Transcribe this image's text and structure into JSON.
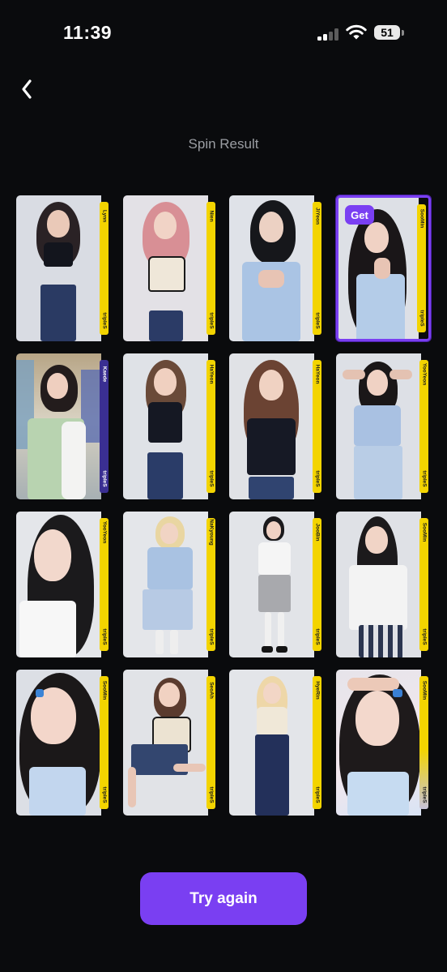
{
  "status_bar": {
    "time": "11:39",
    "battery": "51"
  },
  "page": {
    "title": "Spin Result"
  },
  "cards": [
    {
      "member": "Lynn",
      "brand": "tripleS",
      "strip_color": "yellow"
    },
    {
      "member": "Nien",
      "brand": "tripleS",
      "strip_color": "yellow"
    },
    {
      "member": "JiYeon",
      "brand": "tripleS",
      "strip_color": "yellow"
    },
    {
      "member": "SooMin",
      "brand": "tripleS",
      "strip_color": "yellow",
      "badge": "Get"
    },
    {
      "member": "Kaede",
      "brand": "tripleS",
      "strip_color": "purple"
    },
    {
      "member": "HaYeon",
      "brand": "tripleS",
      "strip_color": "yellow"
    },
    {
      "member": "HaYeon",
      "brand": "tripleS",
      "strip_color": "yellow"
    },
    {
      "member": "YooYeon",
      "brand": "tripleS",
      "strip_color": "yellow"
    },
    {
      "member": "YooYeon",
      "brand": "tripleS",
      "strip_color": "yellow"
    },
    {
      "member": "NaKyoung",
      "brand": "tripleS",
      "strip_color": "yellow"
    },
    {
      "member": "JooBin",
      "brand": "tripleS",
      "strip_color": "yellow"
    },
    {
      "member": "SooMin",
      "brand": "tripleS",
      "strip_color": "yellow"
    },
    {
      "member": "SooMin",
      "brand": "tripleS",
      "strip_color": "yellow"
    },
    {
      "member": "SeoAh",
      "brand": "tripleS",
      "strip_color": "yellow"
    },
    {
      "member": "HyeRin",
      "brand": "tripleS",
      "strip_color": "yellow"
    },
    {
      "member": "SooMin",
      "brand": "tripleS",
      "strip_color": "yellow"
    }
  ],
  "actions": {
    "try_again_label": "Try again"
  },
  "colors": {
    "accent": "#7a3ff2",
    "background": "#0a0b0d",
    "strip_yellow": "#f3d400",
    "strip_purple": "#3a2f92"
  }
}
